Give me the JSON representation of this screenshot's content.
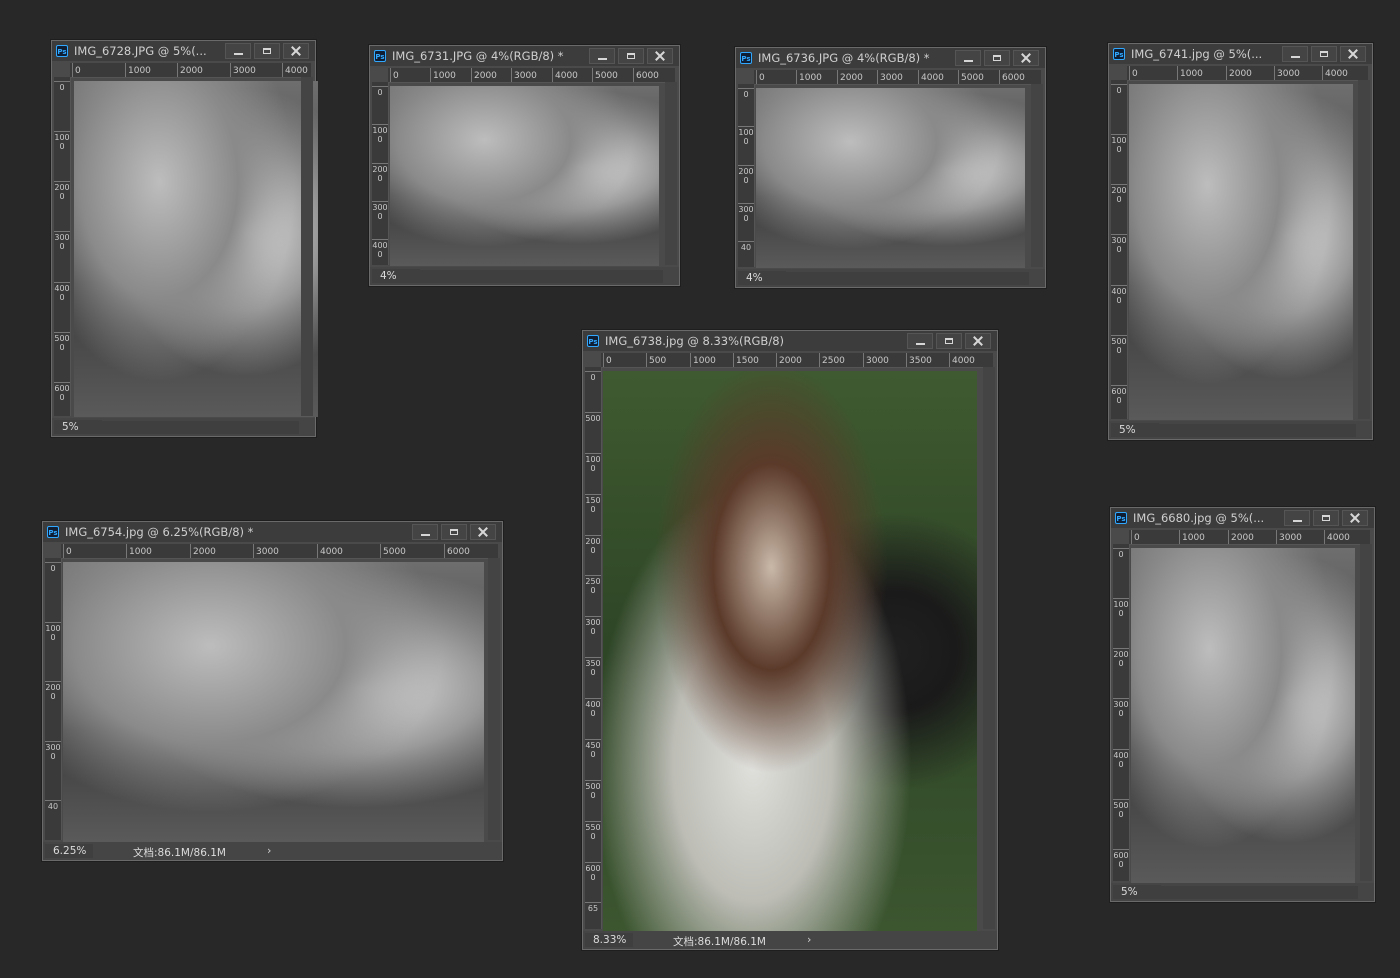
{
  "workspace": {
    "background": "#282828"
  },
  "windows": [
    {
      "title": "IMG_6728.JPG @ 5%(...",
      "zoom": "5%",
      "ruler_h": [
        "0",
        "1000",
        "2000",
        "3000",
        "4000"
      ],
      "ruler_v": [
        "0",
        "1000",
        "2000",
        "3000",
        "4000",
        "5000",
        "6000"
      ],
      "photo": "bw",
      "docinfo": ""
    },
    {
      "title": "IMG_6731.JPG @ 4%(RGB/8) *",
      "zoom": "4%",
      "ruler_h": [
        "0",
        "1000",
        "2000",
        "3000",
        "4000",
        "5000",
        "6000"
      ],
      "ruler_v": [
        "0",
        "1000",
        "2000",
        "3000",
        "4000"
      ],
      "photo": "bw",
      "docinfo": ""
    },
    {
      "title": "IMG_6736.JPG @ 4%(RGB/8) *",
      "zoom": "4%",
      "ruler_h": [
        "0",
        "1000",
        "2000",
        "3000",
        "4000",
        "5000",
        "6000"
      ],
      "ruler_v": [
        "0",
        "1000",
        "2000",
        "3000",
        "40"
      ],
      "photo": "bw",
      "docinfo": ""
    },
    {
      "title": "IMG_6741.jpg @ 5%(...",
      "zoom": "5%",
      "ruler_h": [
        "0",
        "1000",
        "2000",
        "3000",
        "4000"
      ],
      "ruler_v": [
        "0",
        "1000",
        "2000",
        "3000",
        "4000",
        "5000",
        "6000"
      ],
      "photo": "bw",
      "docinfo": ""
    },
    {
      "title": "IMG_6738.jpg @ 8.33%(RGB/8)",
      "zoom": "8.33%",
      "ruler_h": [
        "0",
        "500",
        "1000",
        "1500",
        "2000",
        "2500",
        "3000",
        "3500",
        "4000"
      ],
      "ruler_v": [
        "0",
        "500",
        "1000",
        "1500",
        "2000",
        "2500",
        "3000",
        "3500",
        "4000",
        "4500",
        "5000",
        "5500",
        "6000",
        "65"
      ],
      "photo": "color",
      "docinfo": "文档:86.1M/86.1M"
    },
    {
      "title": "IMG_6754.jpg @ 6.25%(RGB/8) *",
      "zoom": "6.25%",
      "ruler_h": [
        "0",
        "1000",
        "2000",
        "3000",
        "4000",
        "5000",
        "6000"
      ],
      "ruler_v": [
        "0",
        "1000",
        "2000",
        "3000",
        "40"
      ],
      "photo": "bw",
      "docinfo": "文档:86.1M/86.1M"
    },
    {
      "title": "IMG_6680.jpg @ 5%(...",
      "zoom": "5%",
      "ruler_h": [
        "0",
        "1000",
        "2000",
        "3000",
        "4000"
      ],
      "ruler_v": [
        "0",
        "1000",
        "2000",
        "3000",
        "4000",
        "5000",
        "6000"
      ],
      "photo": "bw",
      "docinfo": ""
    }
  ],
  "icons": {
    "app": "photoshop-icon",
    "minimize": "minimize-icon",
    "maximize": "maximize-icon",
    "close": "close-icon",
    "more": "chevron-right-icon"
  },
  "labels": {
    "app_icon_text": "Ps",
    "more_arrow": "›"
  },
  "colors": {
    "title_bg": "#3c3c3c",
    "window_bg": "#4a4a4a",
    "accent": "#31a8ff"
  }
}
